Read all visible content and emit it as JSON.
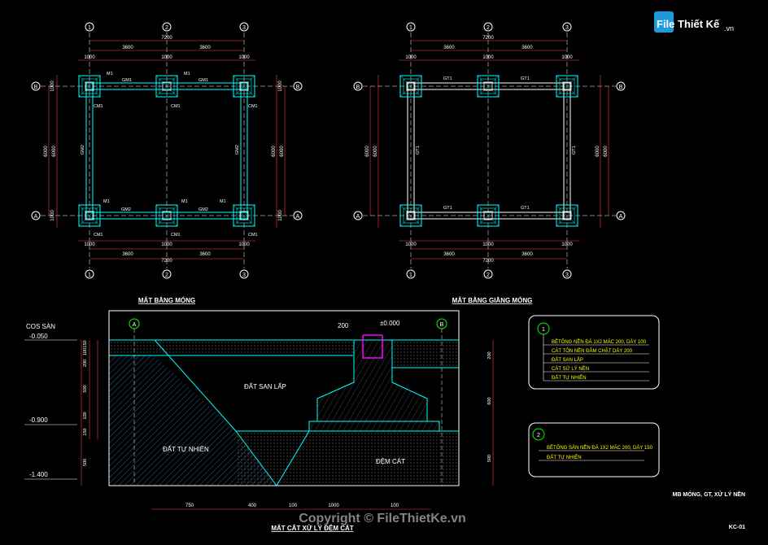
{
  "logo": {
    "text": "File Thiết Kế",
    "domain": ".vn"
  },
  "plan_left": {
    "title": "MẶT BẰNG MÓNG",
    "dim_top_total": "7200",
    "dim_top_a": "3600",
    "dim_top_b": "3600",
    "dim_top_c1": "1000",
    "dim_top_c2": "1000",
    "dim_top_c3": "1000",
    "dim_left_total": "6000",
    "dim_right_total": "6000",
    "dim_side_small": "1000",
    "axes_cols": [
      "1",
      "2",
      "3"
    ],
    "axes_rows": [
      "B",
      "A"
    ],
    "labels": {
      "m1": "M1",
      "gm1": "GM1",
      "gm2": "GM2",
      "cm1": "CM1"
    }
  },
  "plan_right": {
    "title": "MẶT BẰNG GIẰNG MÓNG",
    "dim_top_total": "7200",
    "dim_top_a": "3600",
    "dim_top_b": "3600",
    "dim_top_c": "1000",
    "dim_left_total": "6000",
    "dim_right_total": "6000",
    "axes_cols": [
      "1",
      "2",
      "3"
    ],
    "axes_rows": [
      "B",
      "A"
    ],
    "label_beam": "GT1"
  },
  "section": {
    "title": "MẶT CẮT XỬ LÝ ĐỆM CÁT",
    "cos_san": "COS SÀN",
    "lvl1": "-0.050",
    "lvl2": "-0.900",
    "lvl3": "-1.400",
    "zero": "±0.000",
    "dim200": "200",
    "soil_fill": "ĐẤT SAN LẤP",
    "soil_natural": "ĐẤT TỰ NHIÊN",
    "sand": "ĐỆM CÁT",
    "axis_left": "A",
    "axis_right": "B",
    "dim_bottom": [
      "750",
      "400",
      "100",
      "1000",
      "100"
    ],
    "dim_left": [
      "150",
      "100",
      "200",
      "500",
      "100",
      "150",
      "500"
    ],
    "dim_right": [
      "200",
      "600",
      "500"
    ]
  },
  "legend1": {
    "tag": "1",
    "lines": [
      "BÊTÔNG NỀN ĐÁ 1X2 MÁC 200, DÀY 100",
      "CÁT TÔN NỀN ĐẦM CHẶT DÀY 200",
      "ĐẤT SAN LẤP",
      "CÁT SỬ LÝ NỀN",
      "ĐẤT TỰ NHIÊN"
    ]
  },
  "legend2": {
    "tag": "2",
    "lines": [
      "BÊTÔNG SÀN NỀN ĐÁ 1X2 MÁC 200, DÀY 150",
      "ĐẤT TỰ NHIÊN"
    ]
  },
  "sheet": {
    "name": "MB MÓNG, GT, XỬ LÝ NỀN",
    "code": "KC-01"
  },
  "watermark": "Copyright © FileThietKe.vn",
  "colors": {
    "bg": "#000000",
    "cyan": "#00ffff",
    "white": "#ffffff",
    "red": "#ff0000",
    "green": "#00ff00",
    "yellow": "#ffff00",
    "magenta": "#ff00ff"
  }
}
